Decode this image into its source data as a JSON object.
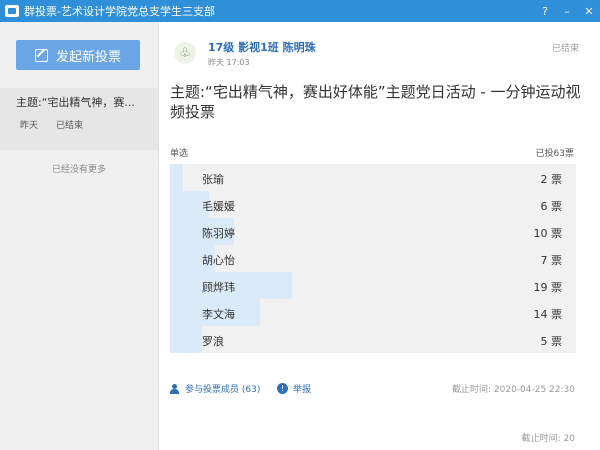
{
  "window": {
    "title": "群投票-艺术设计学院党总支学生三支部",
    "controls": [
      "?",
      "–",
      "✕"
    ]
  },
  "sidebar": {
    "new_vote_label": "发起新投票",
    "items": [
      {
        "topic": "主题:“宅出精气神，赛...",
        "date": "昨天",
        "status": "已结束"
      }
    ],
    "no_more": "已经没有更多"
  },
  "main": {
    "avatar_glyph": "♧",
    "group_name": "17级 影视1班 陈明珠",
    "post_time": "昨天 17:03",
    "state": "已结束",
    "subject": "主题:“宅出精气神，赛出好体能”主题党日活动 - 一分钟运动视频投票",
    "vote_type": "单选",
    "vote_total": "已投63票",
    "options": [
      {
        "name": "张瑜",
        "votes": 2,
        "votes_label": "2 票"
      },
      {
        "name": "毛媛媛",
        "votes": 6,
        "votes_label": "6 票"
      },
      {
        "name": "陈羽婷",
        "votes": 10,
        "votes_label": "10 票"
      },
      {
        "name": "胡心怡",
        "votes": 7,
        "votes_label": "7 票"
      },
      {
        "name": "顾烨玮",
        "votes": 19,
        "votes_label": "19 票"
      },
      {
        "name": "李文海",
        "votes": 14,
        "votes_label": "14 票"
      },
      {
        "name": "罗浪",
        "votes": 5,
        "votes_label": "5 票"
      }
    ],
    "participants_label": "参与投票成员 (63)",
    "report_label": "举报",
    "deadline": "截止时间: 2020-04-25 22:30",
    "deadline_partial": "截止时间: 20"
  },
  "colors": {
    "titlebar": "#2f8fd8",
    "button": "#6aa6e6",
    "link": "#2f6fb7",
    "bar_fill": "#dbeaf8",
    "bar_bg": "#f1f1f2"
  }
}
